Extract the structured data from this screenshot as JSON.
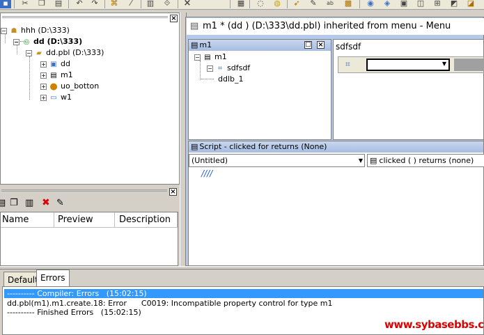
{
  "toolbar": {
    "icons": [
      "save-icon",
      "cut-icon",
      "copy-icon",
      "paste-icon",
      "undo-icon",
      "redo-icon",
      "find-icon",
      "clear-icon",
      "script-icon",
      "browser-icon",
      "close-icon",
      "grid-icon",
      "comment-icon",
      "uncomment-icon",
      "run-icon",
      "debug-icon",
      "sort-icon",
      "library-icon",
      "build-icon",
      "deploy-icon",
      "profile-icon",
      "db-icon",
      "pipe-icon",
      "app-icon",
      "window-icon"
    ]
  },
  "tree": {
    "nodes": [
      {
        "label": "hhh (D:\\333)",
        "bold": false
      },
      {
        "label": "dd (D:\\333)",
        "bold": true
      },
      {
        "label": "dd.pbl (D:\\333)",
        "bold": false
      },
      {
        "label": "dd",
        "bold": false
      },
      {
        "label": "m1",
        "bold": false
      },
      {
        "label": "uo_botton",
        "bold": false
      },
      {
        "label": "w1",
        "bold": false
      }
    ]
  },
  "list": {
    "columns": [
      "Name",
      "Preview",
      "Description"
    ]
  },
  "painter": {
    "title": "m1 * (dd ) (D:\\333\\dd.pbl) inherited from menu - Menu",
    "menu_pane": {
      "title": "m1",
      "items": [
        "m1",
        "sdfsdf",
        "ddlb_1"
      ]
    },
    "item_pane": {
      "title": "sdfsdf"
    },
    "script": {
      "title": "Script - clicked for  returns (None)",
      "object_select": "(Untitled)",
      "event_select": "clicked ( ) returns (none)",
      "code": "////"
    }
  },
  "output": {
    "tabs": [
      "Default",
      "Errors"
    ],
    "active_tab": "Errors",
    "lines": [
      "---------- Compiler: Errors   (15:02:15)",
      "dd.pbl(m1).m1.create.18: Error      C0019: Incompatible property control for type m1",
      "---------- Finished Errors   (15:02:15)"
    ]
  },
  "watermark": "www.sybasebbs.com",
  "colors": {
    "selection": "#3399ff",
    "title_bar": "#a7bde2",
    "watermark": "#e00000",
    "tree_icon_gold": "#c89020"
  }
}
